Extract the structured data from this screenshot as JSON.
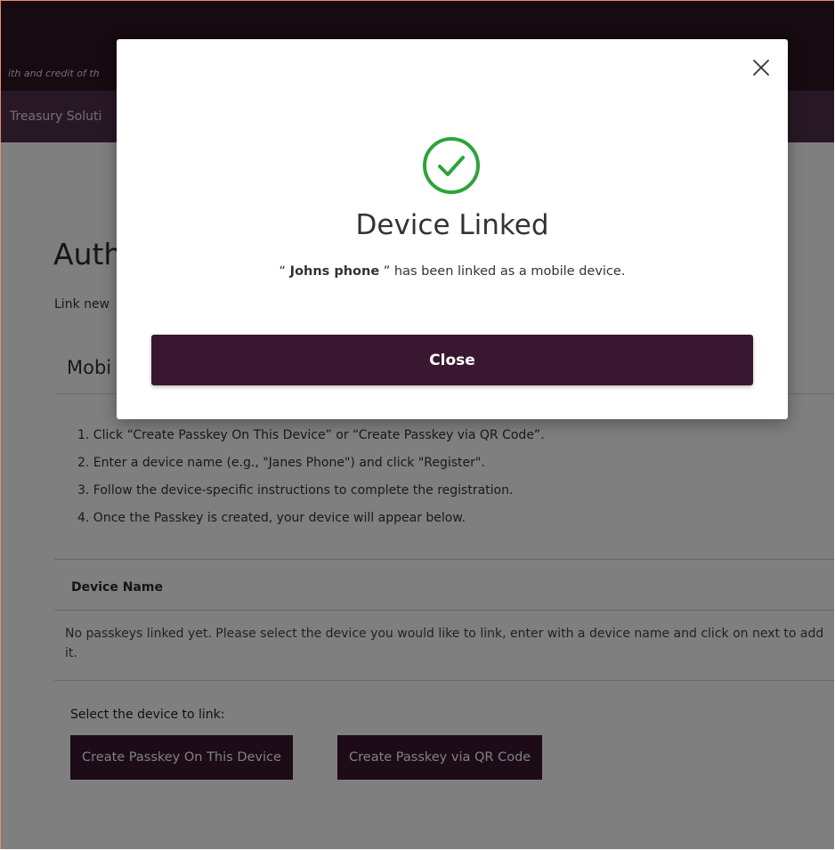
{
  "header": {
    "tagline": "ith and credit of th",
    "nav_text": "Treasury Soluti"
  },
  "page": {
    "title": "Auth",
    "intro": "Link new",
    "section_heading": "Mobi",
    "steps": [
      "1. Click “Create Passkey On This Device” or “Create Passkey via QR Code”.",
      "2. Enter a device name (e.g., \"Janes Phone\") and click \"Register\".",
      "3. Follow the device-specific instructions to complete the registration.",
      "4. Once the Passkey is created, your device will appear below."
    ],
    "table": {
      "column_header": "Device Name",
      "empty_message": "No passkeys linked yet. Please select the device you would like to link, enter with a device name and click on next to add it."
    },
    "select_label": "Select the device to link:",
    "buttons": {
      "create_on_device": "Create Passkey On This Device",
      "create_via_qr": "Create Passkey via QR Code"
    }
  },
  "modal": {
    "title": "Device Linked",
    "message_prefix": "“ ",
    "device_name": "Johns phone",
    "message_suffix": " ” has been linked as a mobile device.",
    "close_button": "Close",
    "close_icon": "close-icon",
    "status_icon": "check-circle-icon"
  },
  "colors": {
    "brand_dark": "#3a1730",
    "header_bg": "#2e1423",
    "nav_bg": "#51304a",
    "success": "#2ea43a"
  }
}
